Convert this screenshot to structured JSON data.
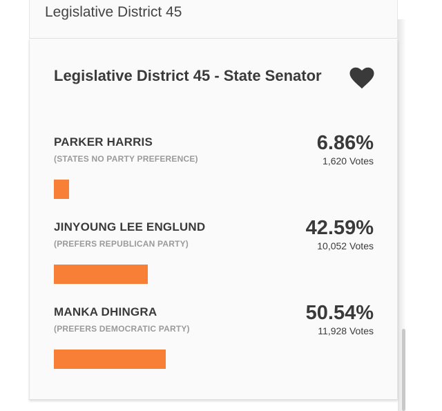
{
  "previous_section": {
    "title": "Legislative District 45"
  },
  "race": {
    "title": "Legislative District 45 - State Senator",
    "favorite_icon": "heart-icon",
    "bar_color": "#f77f36",
    "candidates": [
      {
        "name": "PARKER HARRIS",
        "party": "(STATES NO PARTY PREFERENCE)",
        "percent": "6.86%",
        "percent_value": 6.86,
        "votes": "1,620 Votes"
      },
      {
        "name": "JINYOUNG LEE ENGLUND",
        "party": "(PREFERS REPUBLICAN PARTY)",
        "percent": "42.59%",
        "percent_value": 42.59,
        "votes": "10,052 Votes"
      },
      {
        "name": "MANKA DHINGRA",
        "party": "(PREFERS DEMOCRATIC PARTY)",
        "percent": "50.54%",
        "percent_value": 50.54,
        "votes": "11,928 Votes"
      }
    ]
  }
}
